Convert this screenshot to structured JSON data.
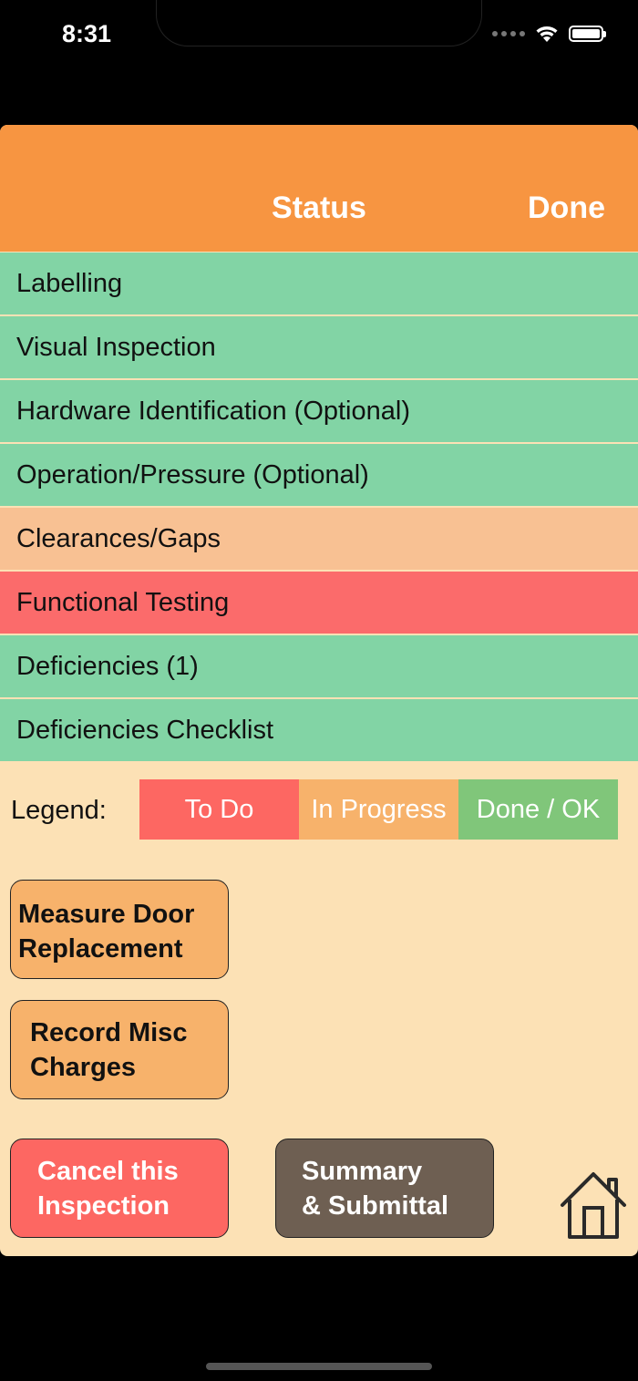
{
  "status_bar": {
    "time": "8:31"
  },
  "header": {
    "title": "Status",
    "done_label": "Done",
    "color": "#f79541"
  },
  "sections": [
    {
      "label": "Labelling",
      "state": "done"
    },
    {
      "label": "Visual Inspection",
      "state": "done"
    },
    {
      "label": "Hardware Identification (Optional)",
      "state": "done"
    },
    {
      "label": "Operation/Pressure (Optional)",
      "state": "done"
    },
    {
      "label": "Clearances/Gaps",
      "state": "in_progress"
    },
    {
      "label": "Functional Testing",
      "state": "todo"
    },
    {
      "label": "Deficiencies (1)",
      "state": "done"
    },
    {
      "label": "Deficiencies Checklist",
      "state": "done"
    }
  ],
  "state_colors": {
    "done": "#82d4a5",
    "in_progress": "#f8c193",
    "todo": "#fb6b6b"
  },
  "legend": {
    "label": "Legend:",
    "todo": "To Do",
    "in_progress": "In Progress",
    "done": "Done / OK",
    "colors": {
      "todo": "#fd6762",
      "in_progress": "#f7b26b",
      "done": "#80c67a"
    }
  },
  "buttons": {
    "measure_door": {
      "line1": "Measure Door",
      "line2": "Replacement",
      "color": "#f7b26b"
    },
    "record_misc": {
      "line1": "Record Misc",
      "line2": "Charges",
      "color": "#f7b26b"
    },
    "cancel": {
      "line1": "Cancel this",
      "line2": "Inspection",
      "color": "#fd6762"
    },
    "summary": {
      "line1": "Summary",
      "line2": "& Submittal",
      "color": "#6e5f52"
    }
  },
  "icons": {
    "home": "home-icon",
    "wifi": "wifi-icon",
    "battery": "battery-icon",
    "signal": "cellular-signal-icon"
  },
  "app_background": "#fce1b5"
}
